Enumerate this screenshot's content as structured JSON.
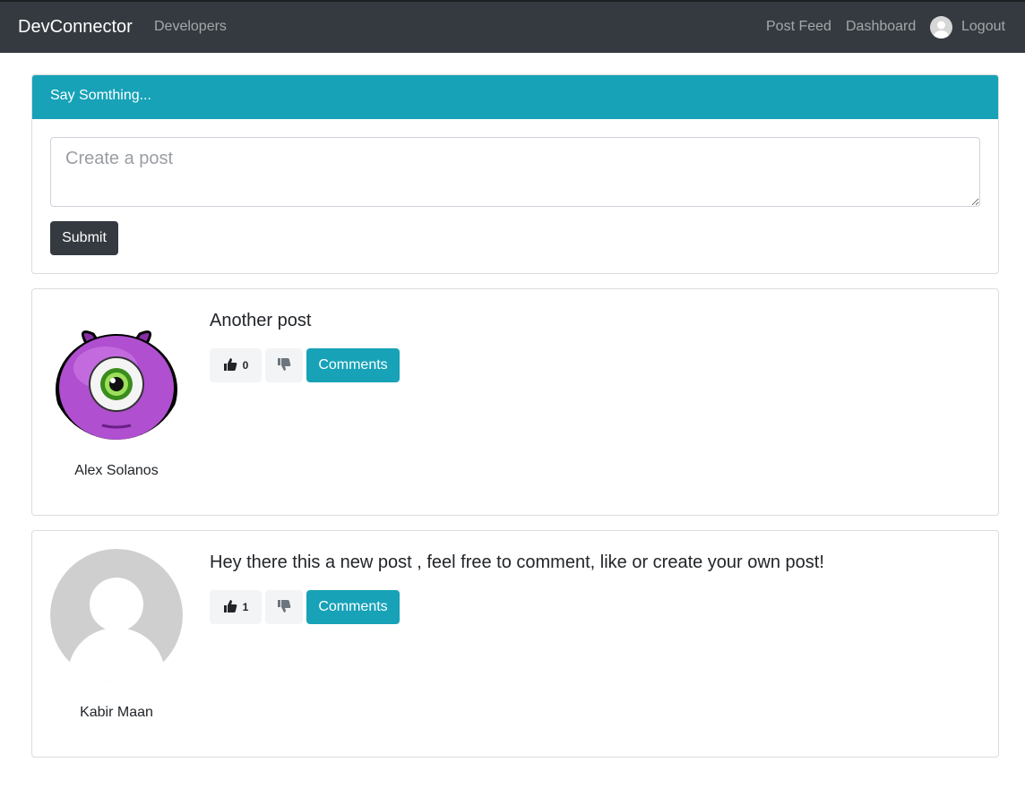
{
  "navbar": {
    "brand": "DevConnector",
    "links": {
      "developers": "Developers",
      "post_feed": "Post Feed",
      "dashboard": "Dashboard",
      "logout": "Logout"
    }
  },
  "post_form": {
    "header": "Say Somthing...",
    "textarea_placeholder": "Create a post",
    "submit_label": "Submit"
  },
  "posts": [
    {
      "author": "Alex Solanos",
      "avatar": "purple-monster-icon",
      "text": "Another post",
      "likes": "0",
      "comments_label": "Comments"
    },
    {
      "author": "Kabir Maan",
      "avatar": "default-user-icon",
      "text": "Hey there this a new post , feel free to comment, like or create your own post!",
      "likes": "1",
      "comments_label": "Comments"
    }
  ],
  "colors": {
    "navbar": "#343a40",
    "accent": "#17a2b8",
    "dark_button": "#343a40"
  }
}
